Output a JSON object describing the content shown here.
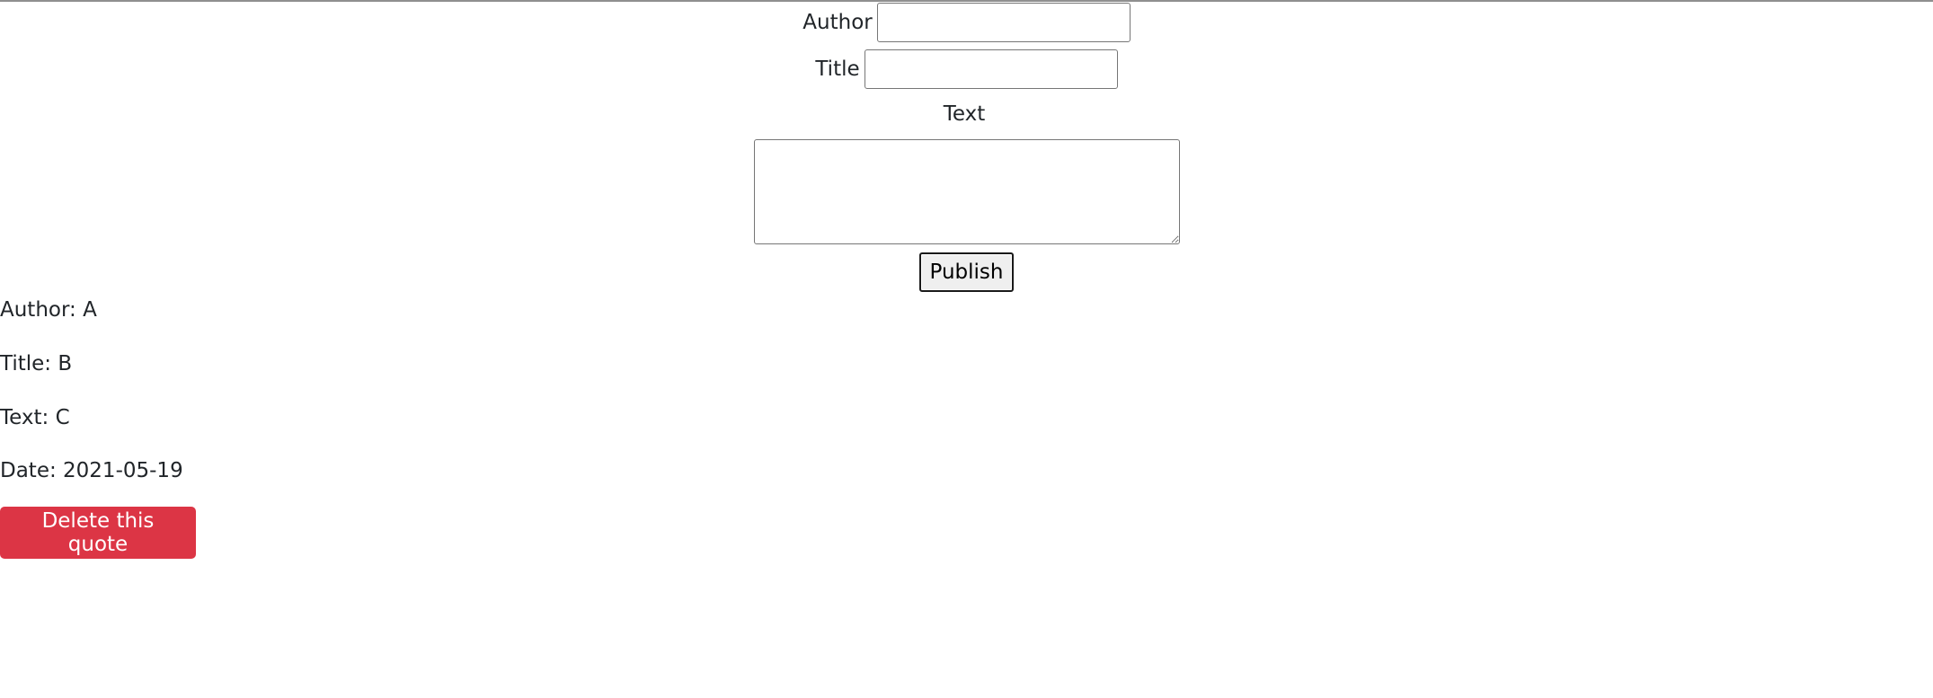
{
  "form": {
    "author_label": "Author",
    "author_value": "",
    "title_label": "Title",
    "title_value": "",
    "text_label": "Text",
    "text_value": "",
    "publish_label": "Publish"
  },
  "quote": {
    "author_line": "Author: A",
    "title_line": "Title: B",
    "text_line": "Text: C",
    "date_line": "Date: 2021-05-19",
    "delete_label": "Delete this quote"
  },
  "colors": {
    "delete_button": "#dc3545",
    "text": "#212529"
  }
}
